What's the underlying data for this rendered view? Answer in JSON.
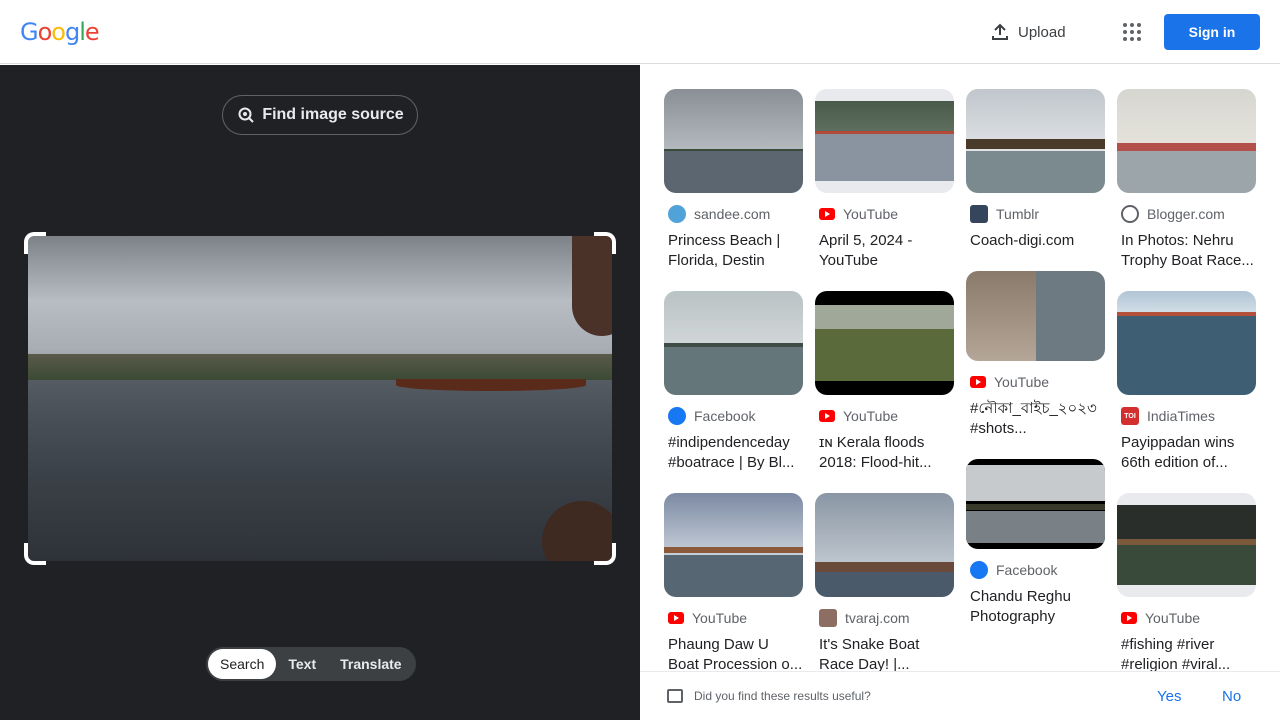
{
  "header": {
    "logo": [
      "G",
      "o",
      "o",
      "g",
      "l",
      "e"
    ],
    "upload_label": "Upload",
    "signin_label": "Sign in"
  },
  "left": {
    "find_source_label": "Find image source",
    "modes": [
      "Search",
      "Text",
      "Translate"
    ],
    "active_mode": "Search"
  },
  "results": {
    "col1": [
      {
        "source": "sandee.com",
        "title": "Princess Beach | Florida, Destin",
        "icon": "sandee-icon"
      },
      {
        "source": "Facebook",
        "title": "#indipendenceday #boatrace | By Bl...",
        "icon": "facebook-icon"
      },
      {
        "source": "YouTube",
        "title": "Phaung Daw U Boat Procession o...",
        "icon": "youtube-icon"
      }
    ],
    "col2": [
      {
        "source": "YouTube",
        "title": "April 5, 2024 - YouTube",
        "icon": "youtube-icon"
      },
      {
        "source": "YouTube",
        "title": "ɪɴ Kerala floods 2018: Flood-hit...",
        "icon": "youtube-icon"
      },
      {
        "source": "tvaraj.com",
        "title": "It's Snake Boat Race Day! |...",
        "icon": "tvaraj-icon"
      }
    ],
    "col3": [
      {
        "source": "Tumblr",
        "title": "Coach-digi.com",
        "icon": "tumblr-icon"
      },
      {
        "source": "YouTube",
        "title": "#নৌকা_বাইচ_২০২৩ #shots...",
        "icon": "youtube-icon"
      },
      {
        "source": "Facebook",
        "title": "Chandu Reghu Photography",
        "icon": "facebook-icon"
      }
    ],
    "col4": [
      {
        "source": "Blogger.com",
        "title": "In Photos: Nehru Trophy Boat Race...",
        "icon": "blogger-icon"
      },
      {
        "source": "IndiaTimes",
        "title": "Payippadan wins 66th edition of...",
        "icon": "indiatimes-icon"
      },
      {
        "source": "YouTube",
        "title": "#fishing #river #religion #viral...",
        "icon": "youtube-icon"
      }
    ]
  },
  "feedback": {
    "question": "Did you find these results useful?",
    "yes": "Yes",
    "no": "No"
  }
}
